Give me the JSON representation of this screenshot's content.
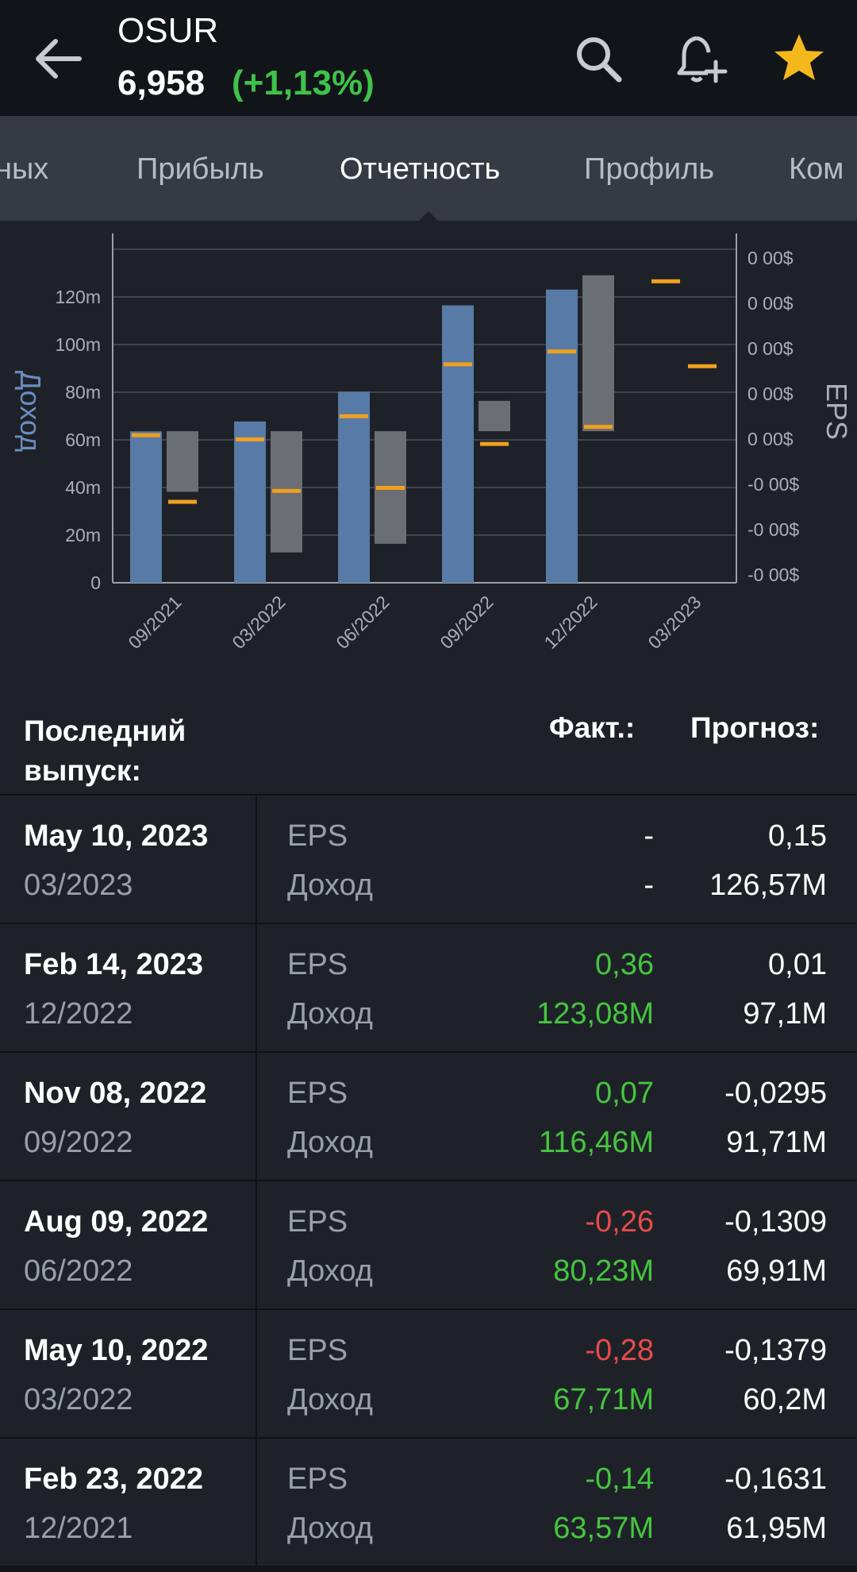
{
  "header": {
    "ticker": "OSUR",
    "price": "6,958",
    "change": "(+1,13%)",
    "colors": {
      "change": "#3fc34a",
      "star": "#f5b81c"
    }
  },
  "tabs": [
    {
      "label": "ных",
      "active": false
    },
    {
      "label": "Прибыль",
      "active": false
    },
    {
      "label": "Отчетность",
      "active": true
    },
    {
      "label": "Профиль",
      "active": false
    },
    {
      "label": "Ком",
      "active": false
    }
  ],
  "chart_data": {
    "type": "bar",
    "ylabel": "Доход",
    "y2label": "EPS",
    "ylim": [
      0,
      140
    ],
    "yticks": [
      "0",
      "20m",
      "40m",
      "60m",
      "80m",
      "100m",
      "120m"
    ],
    "y2ticks": [
      "-0 00$",
      "-0 00$",
      "-0 00$",
      "0 00$",
      "0 00$",
      "0 00$",
      "0 00$",
      "0 00$"
    ],
    "categories": [
      "09/2021",
      "03/2022",
      "06/2022",
      "09/2022",
      "12/2022",
      "03/2023"
    ],
    "revenue": [
      63.57,
      67.71,
      80.23,
      116.46,
      123.08,
      null
    ],
    "revenue_forecast": [
      61.95,
      60.2,
      69.91,
      91.71,
      97.1,
      126.57
    ],
    "eps": [
      -0.14,
      -0.28,
      -0.26,
      0.07,
      0.36,
      null
    ],
    "eps_forecast": [
      -0.1631,
      -0.1379,
      -0.1309,
      -0.0295,
      0.01,
      0.15
    ],
    "colors": {
      "revenue": "#587aa6",
      "eps": "#6b6e72",
      "forecast": "#f0a020",
      "axis": "#9aa0a8"
    }
  },
  "table": {
    "header": {
      "last": "Последний выпуск:",
      "actual": "Факт.:",
      "forecast": "Прогноз:"
    },
    "rows": [
      {
        "date": "May 10, 2023",
        "period": "03/2023",
        "eps_label": "EPS",
        "rev_label": "Доход",
        "eps_actual": "-",
        "eps_class": "neu",
        "rev_actual": "-",
        "rev_class": "neu",
        "eps_forecast": "0,15",
        "rev_forecast": "126,57M"
      },
      {
        "date": "Feb 14, 2023",
        "period": "12/2022",
        "eps_label": "EPS",
        "rev_label": "Доход",
        "eps_actual": "0,36",
        "eps_class": "pos",
        "rev_actual": "123,08M",
        "rev_class": "pos",
        "eps_forecast": "0,01",
        "rev_forecast": "97,1M"
      },
      {
        "date": "Nov 08, 2022",
        "period": "09/2022",
        "eps_label": "EPS",
        "rev_label": "Доход",
        "eps_actual": "0,07",
        "eps_class": "pos",
        "rev_actual": "116,46M",
        "rev_class": "pos",
        "eps_forecast": "-0,0295",
        "rev_forecast": "91,71M"
      },
      {
        "date": "Aug 09, 2022",
        "period": "06/2022",
        "eps_label": "EPS",
        "rev_label": "Доход",
        "eps_actual": "-0,26",
        "eps_class": "neg",
        "rev_actual": "80,23M",
        "rev_class": "pos",
        "eps_forecast": "-0,1309",
        "rev_forecast": "69,91M"
      },
      {
        "date": "May 10, 2022",
        "period": "03/2022",
        "eps_label": "EPS",
        "rev_label": "Доход",
        "eps_actual": "-0,28",
        "eps_class": "neg",
        "rev_actual": "67,71M",
        "rev_class": "pos",
        "eps_forecast": "-0,1379",
        "rev_forecast": "60,2M"
      },
      {
        "date": "Feb 23, 2022",
        "period": "12/2021",
        "eps_label": "EPS",
        "rev_label": "Доход",
        "eps_actual": "-0,14",
        "eps_class": "pos",
        "rev_actual": "63,57M",
        "rev_class": "pos",
        "eps_forecast": "-0,1631",
        "rev_forecast": "61,95M"
      }
    ]
  }
}
